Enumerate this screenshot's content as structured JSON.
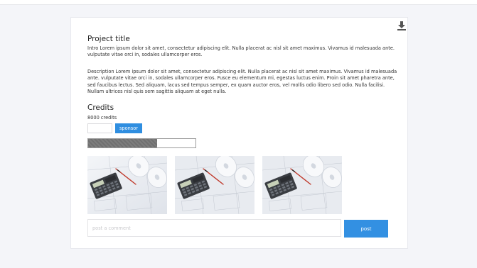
{
  "project": {
    "title": "Project title",
    "intro": "Intro Lorem ipsum dolor sit amet, consectetur adipiscing elit. Nulla placerat ac nisl sit amet maximus. Vivamus id malesuada ante. vulputate vitae orci in, sodales ullamcorper eros.",
    "description": "Description Lorem ipsum dolor sit amet, consectetur adipiscing elit. Nulla placerat ac nisl sit amet maximus. Vivamus id malesuada ante. vulputate vitae orci in, sodales ullamcorper eros. Fusce eu elementum mi, egestas luctus enim. Proin sit amet pharetra ante, sed faucibus lectus. Sed aliquam, lacus sed tempus semper, ex quam auctor eros, vel mollis odio libero sed odio. Nulla facilisi. Nullam ultrices nisl quis sem sagittis aliquam at eget nulla."
  },
  "toolbar": {
    "download_icon": "download-icon"
  },
  "credits": {
    "title": "Credits",
    "count_text": "8000 credits",
    "input_value": "",
    "sponsor_label": "sponsor",
    "progress": 0.64
  },
  "gallery": {
    "photos": [
      {
        "subject": "calculator-blueprints-photo"
      },
      {
        "subject": "calculator-blueprints-photo"
      },
      {
        "subject": "calculator-blueprints-photo"
      }
    ]
  },
  "comment": {
    "placeholder": "post a comment",
    "value": "",
    "post_label": "post"
  },
  "colors": {
    "accent": "#2f8ee0",
    "page_background": "#f4f5f9",
    "progress_fill": "#777777"
  }
}
